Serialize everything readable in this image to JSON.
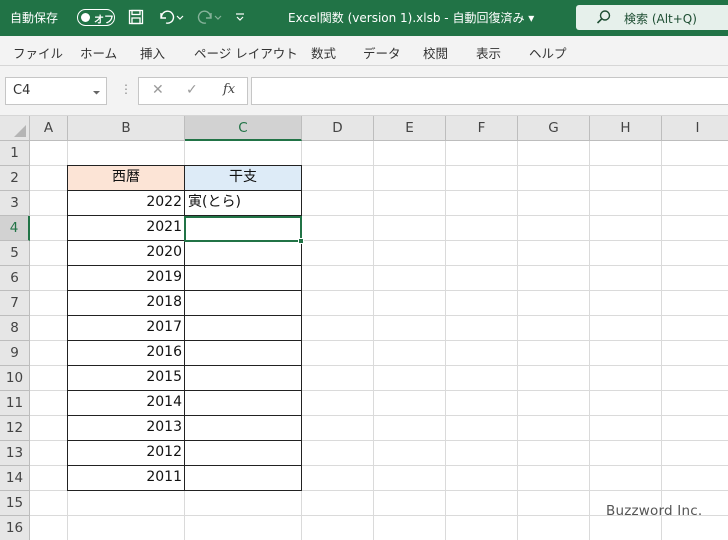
{
  "titlebar": {
    "autosave_label": "自動保存",
    "autosave_state": "オフ",
    "filename": "Excel関数 (version 1).xlsb  -  自動回復済み  ▾",
    "search_label": "検索 (Alt+Q)"
  },
  "ribbon": {
    "tabs": [
      "ファイル",
      "ホーム",
      "挿入",
      "ページ レイアウト",
      "数式",
      "データ",
      "校閲",
      "表示",
      "ヘルプ"
    ]
  },
  "formula_bar": {
    "name_box": "C4",
    "cancel_glyph": "✕",
    "enter_glyph": "✓",
    "fx_label": "fx",
    "formula": ""
  },
  "sheet": {
    "columns": [
      "A",
      "B",
      "C",
      "D",
      "E",
      "F",
      "G",
      "H",
      "I"
    ],
    "rows": [
      "1",
      "2",
      "3",
      "4",
      "5",
      "6",
      "7",
      "8",
      "9",
      "10",
      "11",
      "12",
      "13",
      "14",
      "15",
      "16"
    ],
    "selected_cell": "C4",
    "table": {
      "header_b": "西暦",
      "header_c": "干支",
      "years": [
        "2022",
        "2021",
        "2020",
        "2019",
        "2018",
        "2017",
        "2016",
        "2015",
        "2014",
        "2013",
        "2012",
        "2011"
      ],
      "zodiac": [
        "寅(とら)",
        "",
        "",
        "",
        "",
        "",
        "",
        "",
        "",
        "",
        "",
        ""
      ]
    }
  },
  "watermark": "Buzzword Inc.",
  "colors": {
    "accent": "#217346",
    "header_b_fill": "#fce4d6",
    "header_c_fill": "#ddebf7"
  }
}
